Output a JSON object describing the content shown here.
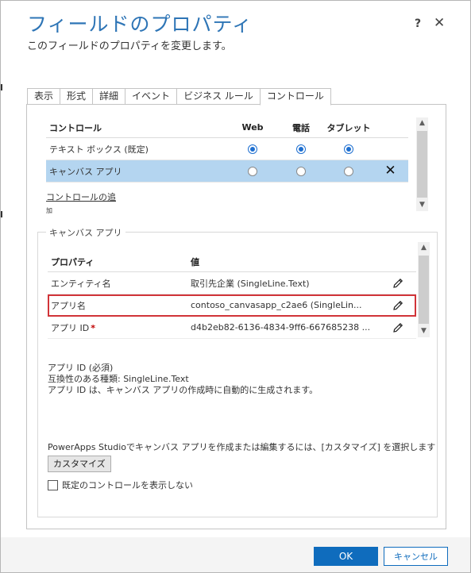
{
  "dialog": {
    "title": "フィールドのプロパティ",
    "subtitle": "このフィールドのプロパティを変更します。",
    "help_label": "?",
    "close_label": "✕"
  },
  "tabs": [
    {
      "label": "表示"
    },
    {
      "label": "形式"
    },
    {
      "label": "詳細"
    },
    {
      "label": "イベント"
    },
    {
      "label": "ビジネス ルール"
    },
    {
      "label": "コントロール",
      "active": true
    }
  ],
  "controls": {
    "headers": {
      "name": "コントロール",
      "web": "Web",
      "phone": "電話",
      "tablet": "タブレット"
    },
    "rows": [
      {
        "name": "テキスト ボックス (既定)",
        "web": true,
        "phone": true,
        "tablet": true
      },
      {
        "name": "キャンバス アプリ",
        "web": false,
        "phone": false,
        "tablet": false,
        "selected": true
      }
    ],
    "add_link": "コントロールの追",
    "add_link_tail": "加"
  },
  "canvas_section": {
    "legend": "キャンバス アプリ",
    "headers": {
      "property": "プロパティ",
      "value": "値"
    },
    "rows": [
      {
        "name": "エンティティ名",
        "value": "取引先企業 (SingleLine.Text)",
        "required": false
      },
      {
        "name": "アプリ名",
        "value": "contoso_canvasapp_c2ae6 (SingleLin...",
        "required": false,
        "highlight": true
      },
      {
        "name": "アプリ ID",
        "value": "d4b2eb82-6136-4834-9ff6-667685238 ...",
        "required": true
      }
    ],
    "required_marker": "*",
    "info": {
      "line1": "アプリ ID (必須)",
      "line2": "互換性のある種類: SingleLine.Text",
      "line3": "アプリ ID は、キャンバス アプリの作成時に自動的に生成されます。"
    },
    "customize_text": "PowerApps Studioでキャンバス アプリを作成または編集するには、[カスタマイズ] を選択します",
    "customize_button": "カスタマイズ",
    "hide_default_label": "既定のコントロールを表示しない"
  },
  "footer": {
    "ok_label": "OK",
    "cancel_label": "キャンセル"
  },
  "colors": {
    "title": "#2e75b6",
    "primary": "#0f6cbd",
    "selected_row": "#b4d5f0",
    "highlight_border": "#d13438",
    "required": "#c00000"
  }
}
